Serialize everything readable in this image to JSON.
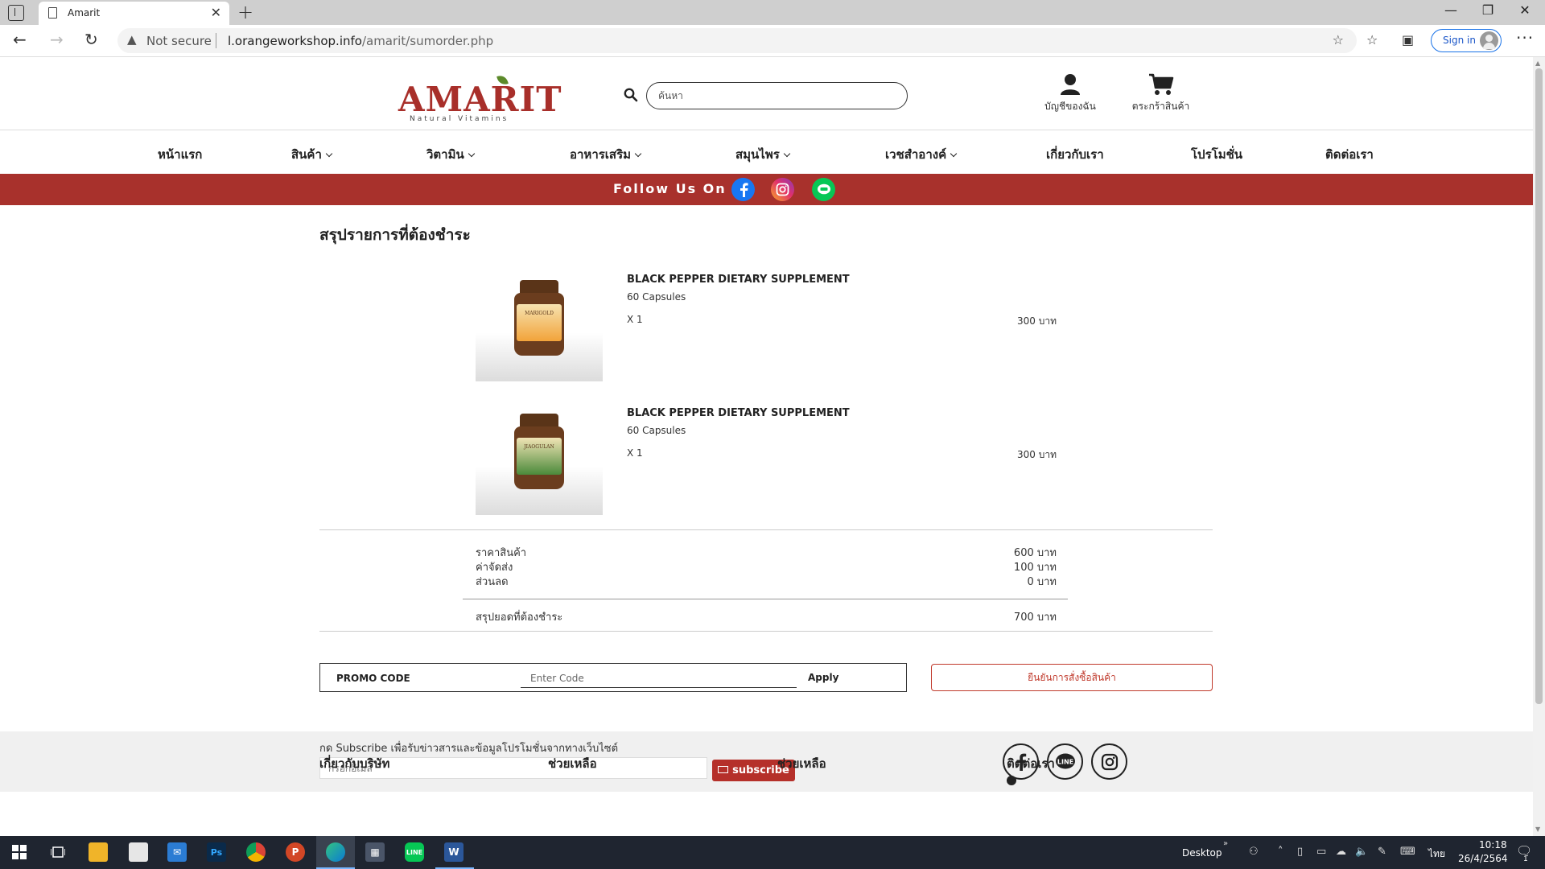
{
  "browser": {
    "tab_title": "Amarit",
    "security_label": "Not secure",
    "url_host": "l.orangeworkshop.info",
    "url_path": "/amarit/sumorder.php",
    "signin_label": "Sign in"
  },
  "header": {
    "logo_word": "AMARIT",
    "logo_tagline": "Natural Vitamins",
    "search_placeholder": "ค้นหา",
    "account_label": "บัญชีของฉัน",
    "cart_label": "ตระกร้าสินค้า"
  },
  "nav": {
    "home": "หน้าแรก",
    "products": "สินค้า",
    "vitamins": "วิตามิน",
    "supplements": "อาหารเสริม",
    "herbs": "สมุนไพร",
    "cosmetics": "เวชสำอางค์",
    "about": "เกี่ยวกับเรา",
    "promotion": "โปรโมชั่น",
    "contact": "ติดต่อเรา"
  },
  "follow": {
    "label": "Follow Us On :",
    "colors": {
      "bar": "#a8312c",
      "facebook": "#1877f2",
      "line": "#06c755"
    }
  },
  "order": {
    "title": "สรุปรายการที่ต้องชำระ",
    "items": [
      {
        "name": "BLACK PEPPER DIETARY SUPPLEMENT",
        "variant": "60 Capsules",
        "qty": "X 1",
        "price": "300 บาท",
        "label_text": "MARIGOLD"
      },
      {
        "name": "BLACK PEPPER DIETARY SUPPLEMENT",
        "variant": "60 Capsules",
        "qty": "X 1",
        "price": "300 บาท",
        "label_text": "JIAOGULAN"
      }
    ],
    "summary": {
      "subtotal_label": "ราคาสินค้า",
      "subtotal_value": "600 บาท",
      "shipping_label": "ค่าจัดส่ง",
      "shipping_value": "100 บาท",
      "discount_label": "ส่วนลด",
      "discount_value": "0 บาท",
      "total_label": "สรุปยอดที่ต้องชำระ",
      "total_value": "700 บาท"
    },
    "promo_label": "PROMO CODE",
    "promo_placeholder": "Enter Code",
    "apply_label": "Apply",
    "confirm_label": "ยืนยันการสั่งซื้อสินค้า"
  },
  "footer": {
    "subscribe_text": "กด Subscribe เพื่อรับข่าวสารและข้อมูลโปรโมชั่นจากทางเว็บไซต์",
    "email_placeholder": "กรอกอีเมล์",
    "subscribe_button": "subscribe",
    "columns": [
      "เกี่ยวกับบริษัท",
      "ช่วยเหลือ",
      "ช่วยเหลือ",
      "ติดต่อเรา"
    ]
  },
  "taskbar": {
    "desktop_label": "Desktop",
    "lang": "ไทย",
    "time": "10:18",
    "date": "26/4/2564",
    "notification_count": "1"
  }
}
